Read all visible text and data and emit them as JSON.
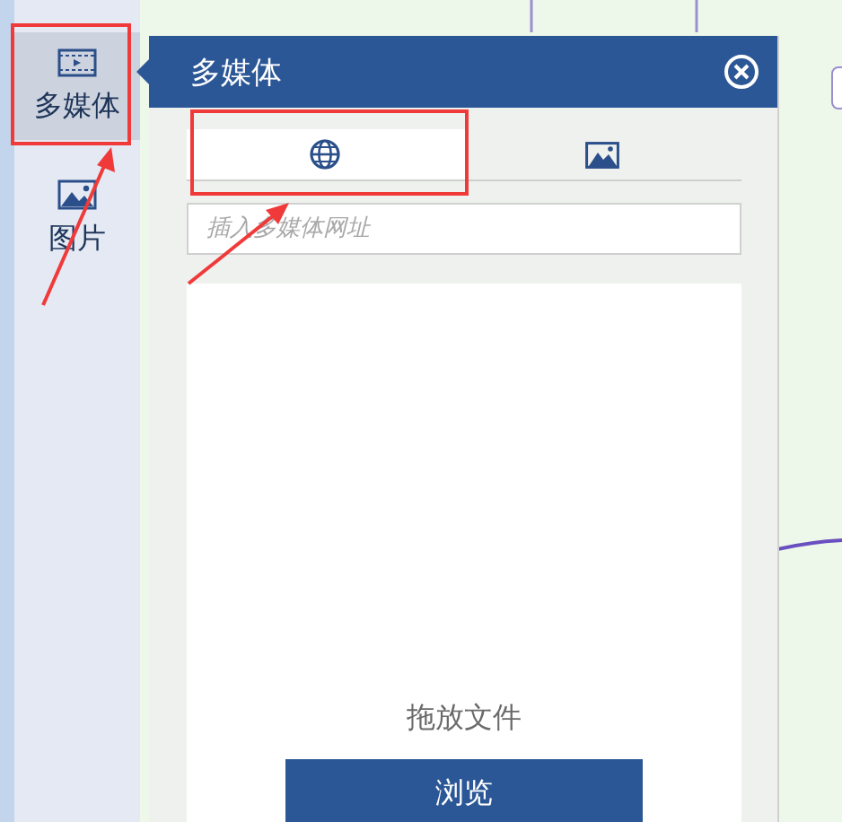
{
  "sidebar": {
    "items": [
      {
        "label": "多媒体",
        "kind": "film",
        "selected": true
      },
      {
        "label": "图片",
        "kind": "image",
        "selected": false
      }
    ]
  },
  "panel": {
    "title": "多媒体",
    "tabs": [
      {
        "kind": "globe",
        "selected": true
      },
      {
        "kind": "image",
        "selected": false
      }
    ],
    "url_field": {
      "placeholder": "插入多媒体网址"
    },
    "drop_zone": {
      "text": "拖放文件",
      "button": "浏览"
    }
  }
}
